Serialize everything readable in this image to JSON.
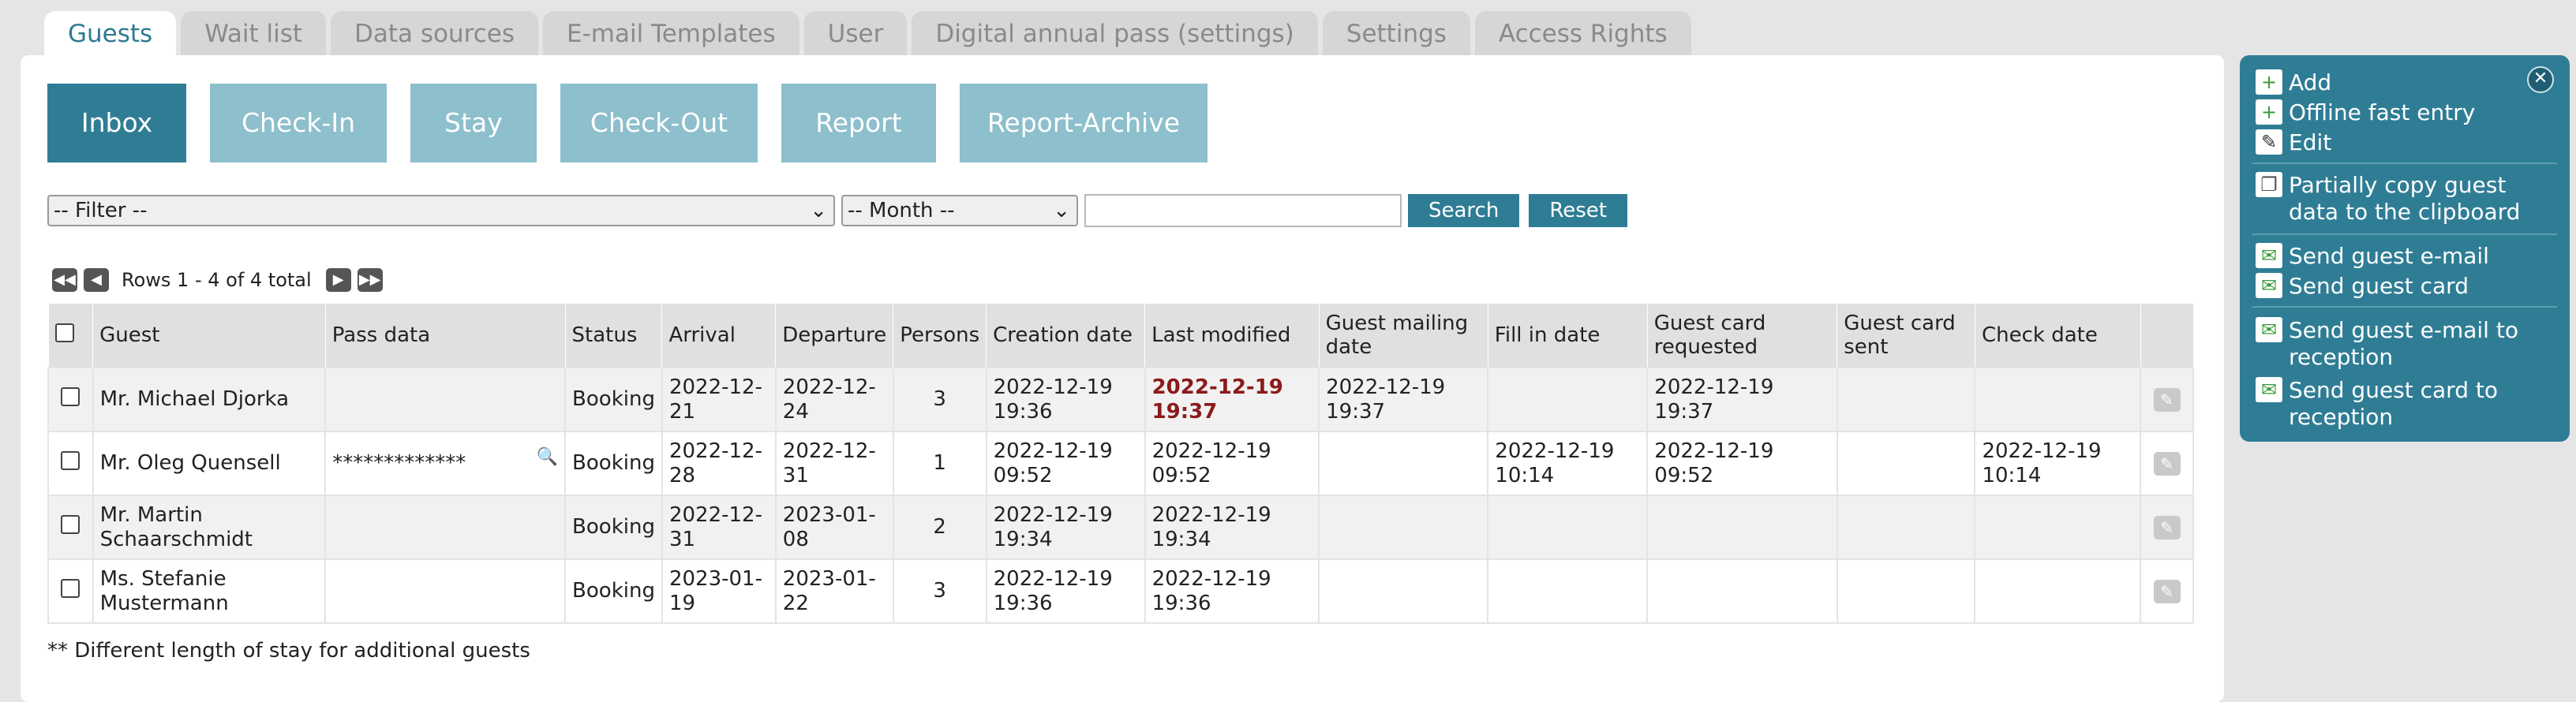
{
  "tabs": [
    "Guests",
    "Wait list",
    "Data sources",
    "E-mail Templates",
    "User",
    "Digital annual pass (settings)",
    "Settings",
    "Access Rights"
  ],
  "buttons": [
    "Inbox",
    "Check-In",
    "Stay",
    "Check-Out",
    "Report",
    "Report-Archive"
  ],
  "filter": {
    "filter_placeholder": "-- Filter --",
    "month_placeholder": "-- Month --",
    "search_label": "Search",
    "reset_label": "Reset"
  },
  "pager": {
    "text": "Rows 1 - 4 of 4 total"
  },
  "table": {
    "headers": [
      "Guest",
      "Pass data",
      "Status",
      "Arrival",
      "Departure",
      "Persons",
      "Creation date",
      "Last modified",
      "Guest mailing date",
      "Fill in date",
      "Guest card requested",
      "Guest card sent",
      "Check date"
    ],
    "rows": [
      {
        "guest": "Mr. Michael Djorka",
        "pass": "",
        "status": "Booking",
        "arrival": "2022-12-21",
        "departure": "2022-12-24",
        "persons": "3",
        "creation": "2022-12-19 19:36",
        "modified": "2022-12-19 19:37",
        "mailing": "2022-12-19 19:37",
        "fillin": "",
        "card_req": "2022-12-19 19:37",
        "card_sent": "",
        "check": ""
      },
      {
        "guest": "Mr. Oleg Quensell",
        "pass": "*************",
        "status": "Booking",
        "arrival": "2022-12-28",
        "departure": "2022-12-31",
        "persons": "1",
        "creation": "2022-12-19 09:52",
        "modified": "2022-12-19 09:52",
        "mailing": "",
        "fillin": "2022-12-19 10:14",
        "card_req": "2022-12-19 09:52",
        "card_sent": "",
        "check": "2022-12-19 10:14"
      },
      {
        "guest": "Mr. Martin Schaarschmidt",
        "pass": "",
        "status": "Booking",
        "arrival": "2022-12-31",
        "departure": "2023-01-08",
        "persons": "2",
        "creation": "2022-12-19 19:34",
        "modified": "2022-12-19 19:34",
        "mailing": "",
        "fillin": "",
        "card_req": "",
        "card_sent": "",
        "check": ""
      },
      {
        "guest": "Ms. Stefanie Mustermann",
        "pass": "",
        "status": "Booking",
        "arrival": "2023-01-19",
        "departure": "2023-01-22",
        "persons": "3",
        "creation": "2022-12-19 19:36",
        "modified": "2022-12-19 19:36",
        "mailing": "",
        "fillin": "",
        "card_req": "",
        "card_sent": "",
        "check": ""
      }
    ]
  },
  "footnote": "** Different length of stay for additional guests",
  "side": {
    "add": "Add",
    "offline": "Offline fast entry",
    "edit": "Edit",
    "copy": "Partially copy guest data to the clipboard",
    "send_email": "Send guest e-mail",
    "send_card": "Send guest card",
    "send_email_reception": "Send guest e-mail to reception",
    "send_card_reception": "Send guest card to reception"
  },
  "colors": {
    "accent": "#2f7d95",
    "button_inactive": "#8dbfcc",
    "highlight_text": "#8b1a1a"
  }
}
